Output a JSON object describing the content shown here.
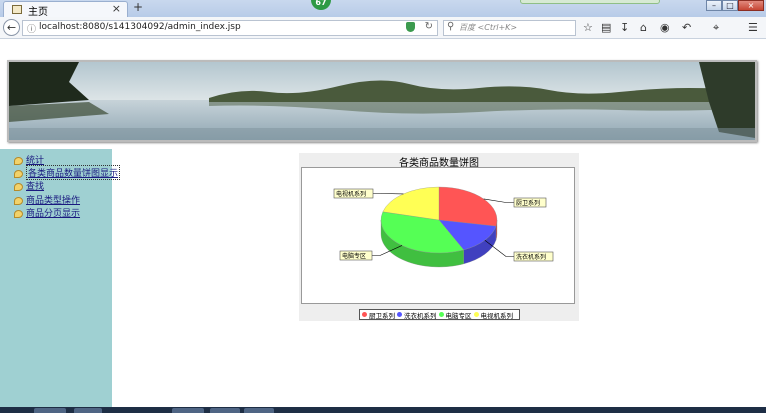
{
  "browser": {
    "tab_title": "主页",
    "tab_close": "×",
    "new_tab": "+",
    "badge_count": "67",
    "url": "localhost:8080/s141304092/admin_index.jsp",
    "search_placeholder": "百度 <Ctrl+K>",
    "window_buttons": [
      "–",
      "□",
      "×"
    ]
  },
  "sidebar": {
    "items": [
      {
        "label": "统计"
      },
      {
        "label": "各类商品数量饼图显示"
      },
      {
        "label": "查找"
      },
      {
        "label": "商品类型操作"
      },
      {
        "label": "商品分页显示"
      }
    ]
  },
  "chart_data": {
    "type": "pie",
    "title": "各类商品数量饼图",
    "categories": [
      "厨卫系列",
      "洗衣机系列",
      "电脑专区",
      "电视机系列"
    ],
    "values": [
      28,
      15,
      36,
      21
    ],
    "colors": [
      "#ff5555",
      "#5555ff",
      "#55ff55",
      "#ffff55"
    ],
    "legend_position": "bottom"
  }
}
